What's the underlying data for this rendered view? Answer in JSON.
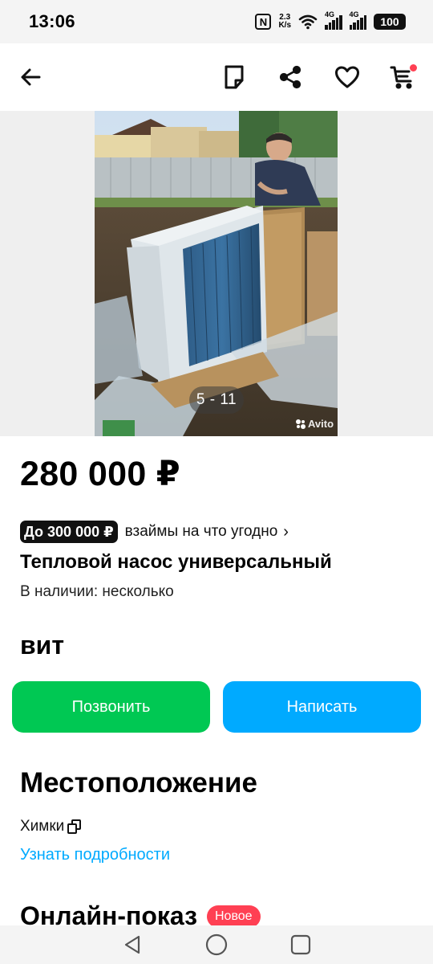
{
  "status_bar": {
    "time": "13:06",
    "nfc_label": "N",
    "net_speed": "2.3",
    "net_unit": "K/s",
    "signal_1_label": "4G",
    "signal_2_label": "4G",
    "battery": "100"
  },
  "app_bar": {
    "back_icon": "arrow-left-icon",
    "note_icon": "note-icon",
    "share_icon": "share-icon",
    "favorite_icon": "heart-icon",
    "cart_icon": "cart-icon",
    "cart_dot_color": "#ff4053"
  },
  "gallery": {
    "counter": "5 - 11",
    "watermark": "Avito"
  },
  "listing": {
    "price": "280 000 ₽",
    "loan_badge": "До 300 000 ₽",
    "loan_text": "взаймы на что угодно",
    "loan_chevron": "›",
    "title": "Тепловой насос универсальный",
    "availability": "В наличии: несколько",
    "seller": "вит"
  },
  "actions": {
    "call_label": "Позвонить",
    "call_color": "#00c853",
    "write_label": "Написать",
    "write_color": "#00aaff"
  },
  "location": {
    "heading": "Местоположение",
    "city": "Химки",
    "details_link": "Узнать подробности",
    "link_color": "#00aaff"
  },
  "online_show": {
    "heading": "Онлайн-показ",
    "badge": "Новое",
    "badge_color": "#ff4053"
  },
  "nav_bar": {
    "back_icon": "triangle-back-icon",
    "home_icon": "circle-home-icon",
    "recents_icon": "square-recents-icon"
  }
}
